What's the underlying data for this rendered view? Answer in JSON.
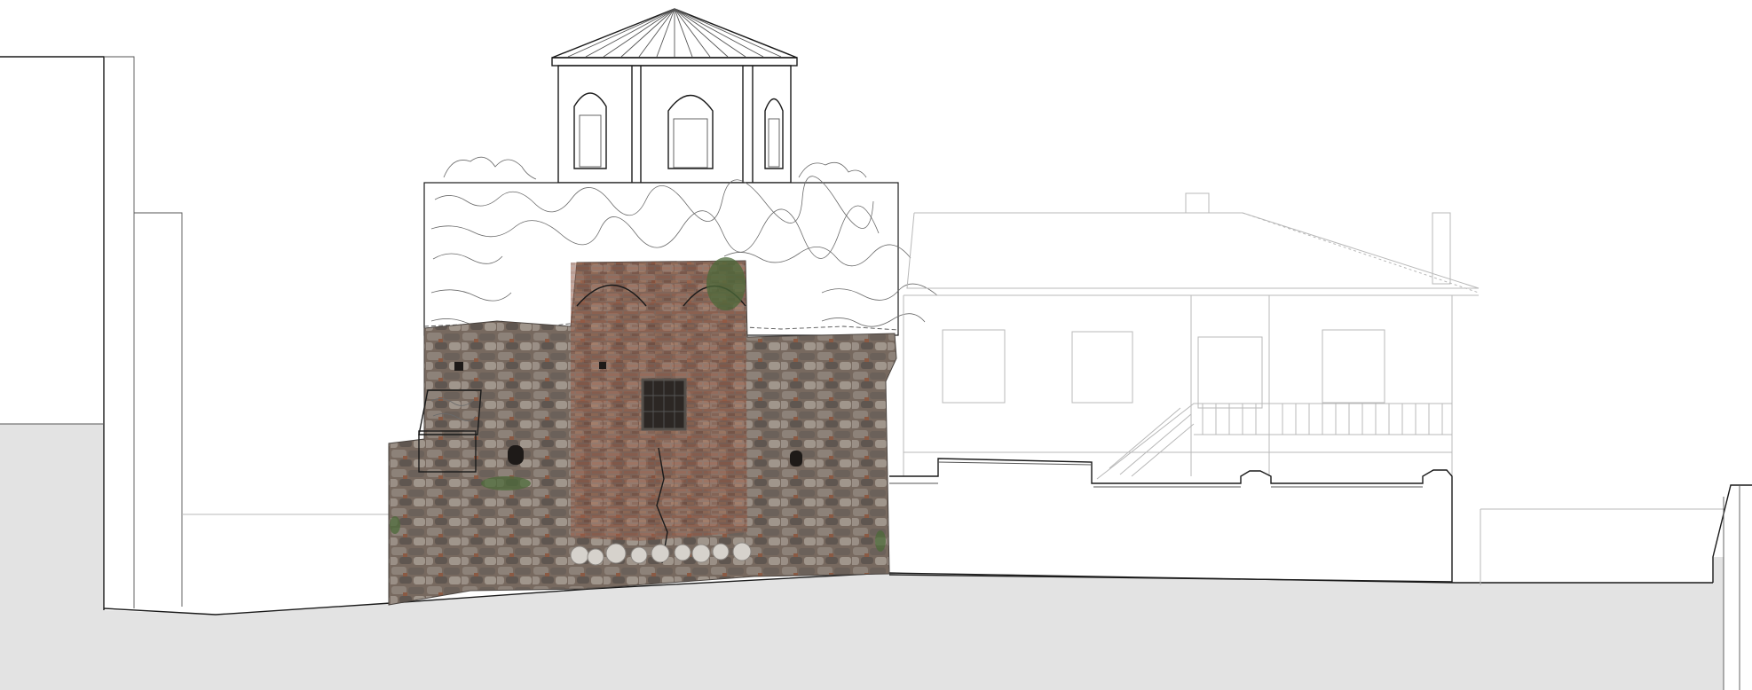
{
  "drawing": {
    "kind": "architectural elevation",
    "colors": {
      "background": "#ffffff",
      "ground": "#e3e3e3",
      "masonry_stone": "#7a7068",
      "masonry_brick": "#8e5a45",
      "line": "#1a1a1a",
      "faint_line": "#b8b8b8"
    }
  }
}
